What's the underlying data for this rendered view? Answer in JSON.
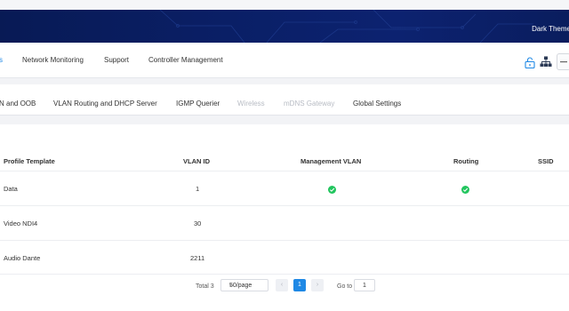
{
  "banner": {
    "theme_label": "Dark Theme"
  },
  "nav": {
    "items": [
      {
        "label": "s",
        "active": true
      },
      {
        "label": "Network Monitoring",
        "active": false
      },
      {
        "label": "Support",
        "active": false
      },
      {
        "label": "Controller Management",
        "active": false
      }
    ],
    "icons": [
      "unlock-icon",
      "topology-icon",
      "more-icon"
    ]
  },
  "subtabs": [
    {
      "label": "N and OOB",
      "disabled": false
    },
    {
      "label": "VLAN Routing and DHCP Server",
      "disabled": false
    },
    {
      "label": "IGMP Querier",
      "disabled": false
    },
    {
      "label": "Wireless",
      "disabled": true
    },
    {
      "label": "mDNS Gateway",
      "disabled": true
    },
    {
      "label": "Global Settings",
      "disabled": false
    }
  ],
  "table": {
    "headers": [
      "Profile Template",
      "VLAN ID",
      "Management VLAN",
      "Routing",
      "SSID"
    ],
    "rows": [
      {
        "profile": "Data",
        "vlan_id": "1",
        "management_vlan": true,
        "routing": true,
        "ssid": ""
      },
      {
        "profile": "Video NDI4",
        "vlan_id": "30",
        "management_vlan": false,
        "routing": false,
        "ssid": ""
      },
      {
        "profile": "Audio Dante",
        "vlan_id": "2211",
        "management_vlan": false,
        "routing": false,
        "ssid": ""
      }
    ]
  },
  "pagination": {
    "total_label": "Total 3",
    "page_size": "50/page",
    "prev": "‹",
    "current_page": "1",
    "next": "›",
    "goto_label": "Go to",
    "goto_value": "1"
  },
  "colors": {
    "accent": "#1e88e5",
    "banner": "#0a1f66",
    "check": "#22c55e"
  }
}
